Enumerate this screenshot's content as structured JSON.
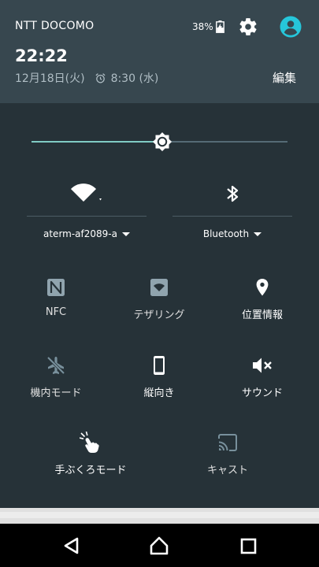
{
  "status_bar": {
    "carrier": "NTT DOCOMO",
    "battery": "38%"
  },
  "header": {
    "time": "22:22",
    "date": "12月18日(火)",
    "alarm": "8:30 (水)",
    "edit_label": "編集"
  },
  "brightness": {
    "value": 0.51
  },
  "wifi": {
    "network": "aterm-af2089-a"
  },
  "bluetooth": {
    "label": "Bluetooth"
  },
  "tiles": {
    "nfc": "NFC",
    "tethering": "テザリング",
    "location": "位置情報",
    "airplane": "機内モード",
    "portrait": "縦向き",
    "sound": "サウンド",
    "glove": "手ぶくろモード",
    "cast": "キャスト"
  },
  "colors": {
    "accent": "#80cbc4",
    "header_bg": "#37474f",
    "panel_bg": "#263238"
  }
}
